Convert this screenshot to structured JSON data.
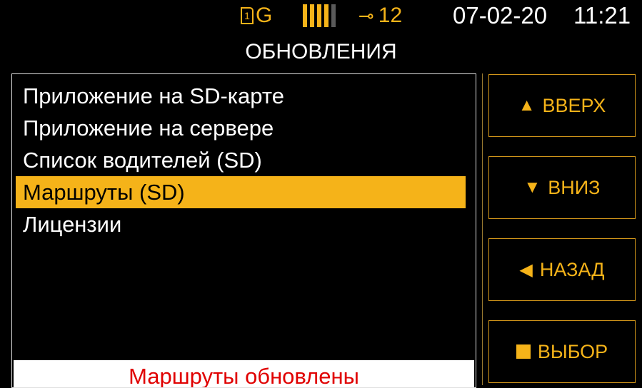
{
  "status_bar": {
    "sim_slot": "1",
    "network": "G",
    "signal_bars_total": 5,
    "signal_bars_active": 4,
    "satellites": "12",
    "date": "07-02-20",
    "time": "11:21",
    "accent_color": "#f5b319"
  },
  "screen": {
    "title": "ОБНОВЛЕНИЯ"
  },
  "menu": {
    "items": [
      {
        "label": "Приложение на SD-карте"
      },
      {
        "label": "Приложение на сервере"
      },
      {
        "label": "Список водителей (SD)"
      },
      {
        "label": "Маршруты (SD)"
      },
      {
        "label": "Лицензии"
      }
    ],
    "selected_index": 3
  },
  "status_message": "Маршруты обновлены",
  "buttons": {
    "up": {
      "icon": "▲",
      "label": "ВВЕРХ"
    },
    "down": {
      "icon": "▼",
      "label": "ВНИЗ"
    },
    "back": {
      "icon": "◀",
      "label": "НАЗАД"
    },
    "select": {
      "icon": "stop-square-icon",
      "label": "ВЫБОР"
    }
  }
}
